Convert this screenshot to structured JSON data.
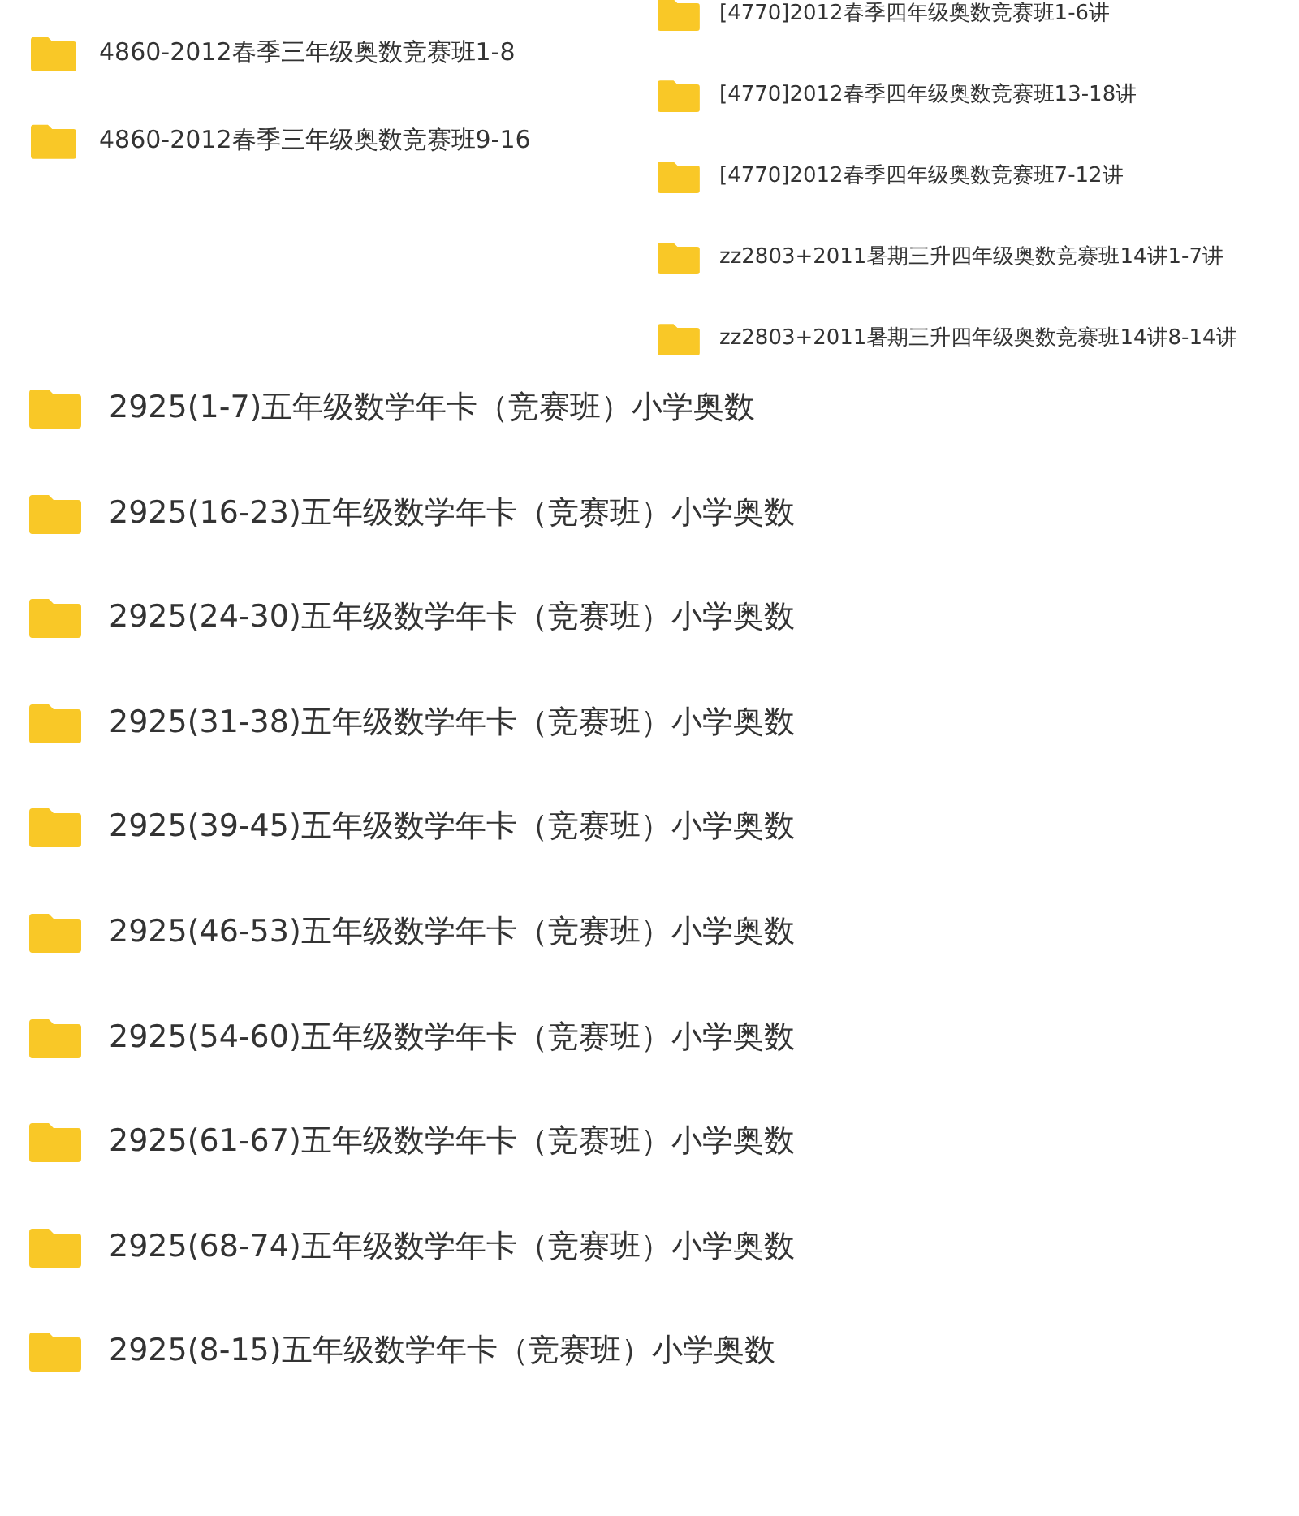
{
  "left_folders": [
    {
      "name": "4860-2012春季三年级奥数竞赛班1-8"
    },
    {
      "name": "4860-2012春季三年级奥数竞赛班9-16"
    }
  ],
  "right_folders": [
    {
      "name": "[4770]2012春季四年级奥数竞赛班1-6讲"
    },
    {
      "name": "[4770]2012春季四年级奥数竞赛班13-18讲"
    },
    {
      "name": "[4770]2012春季四年级奥数竞赛班7-12讲"
    },
    {
      "name": "zz2803+2011暑期三升四年级奥数竞赛班14讲1-7讲"
    },
    {
      "name": "zz2803+2011暑期三升四年级奥数竞赛班14讲8-14讲"
    }
  ],
  "folders": [
    {
      "name": "2925(1-7)五年级数学年卡（竞赛班）小学奥数"
    },
    {
      "name": "2925(16-23)五年级数学年卡（竞赛班）小学奥数"
    },
    {
      "name": "2925(24-30)五年级数学年卡（竞赛班）小学奥数"
    },
    {
      "name": "2925(31-38)五年级数学年卡（竞赛班）小学奥数"
    },
    {
      "name": "2925(39-45)五年级数学年卡（竞赛班）小学奥数"
    },
    {
      "name": "2925(46-53)五年级数学年卡（竞赛班）小学奥数"
    },
    {
      "name": "2925(54-60)五年级数学年卡（竞赛班）小学奥数"
    },
    {
      "name": "2925(61-67)五年级数学年卡（竞赛班）小学奥数"
    },
    {
      "name": "2925(68-74)五年级数学年卡（竞赛班）小学奥数"
    },
    {
      "name": "2925(8-15)五年级数学年卡（竞赛班）小学奥数"
    }
  ]
}
